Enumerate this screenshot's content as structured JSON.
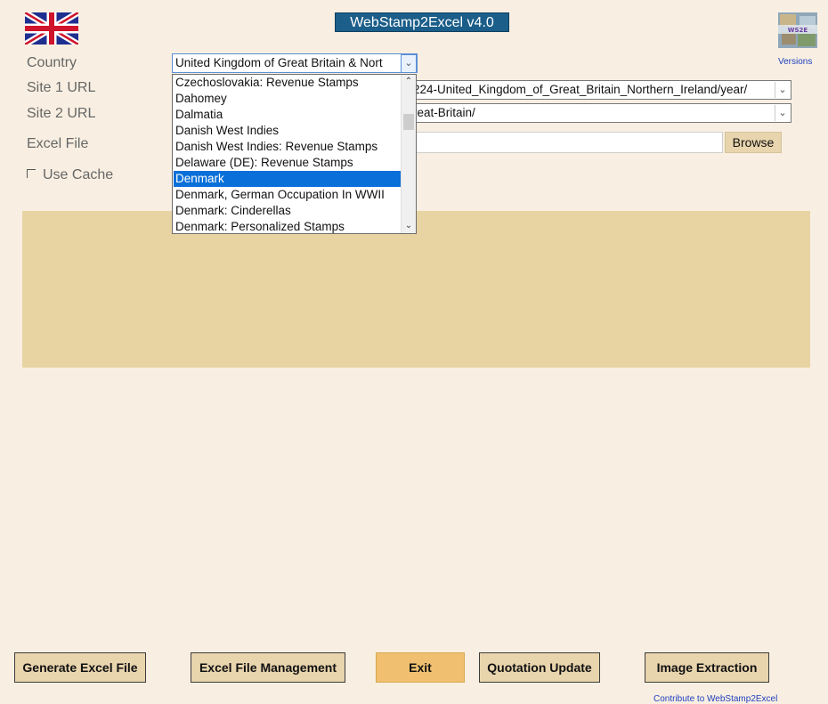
{
  "app": {
    "title": "WebStamp2Excel v4.0"
  },
  "header": {
    "versions_label": "Versions"
  },
  "form": {
    "country_label": "Country",
    "country_value": "United Kingdom of Great Britain & Nort",
    "site1_label": "Site 1 URL",
    "site1_value": "224-United_Kingdom_of_Great_Britain_Northern_Ireland/year/",
    "site2_label": "Site 2 URL",
    "site2_value": "reat-Britain/",
    "excel_label": "Excel File",
    "excel_value": "",
    "browse_label": "Browse",
    "cache_label": "Use Cache",
    "cache_checked": false
  },
  "dropdown": {
    "items": [
      "Czechoslovakia: Revenue Stamps",
      "Dahomey",
      "Dalmatia",
      "Danish West Indies",
      "Danish West Indies: Revenue Stamps",
      "Delaware (DE): Revenue Stamps",
      "Denmark",
      "Denmark, German Occupation In WWII",
      "Denmark: Cinderellas",
      "Denmark: Personalized Stamps"
    ],
    "selected_index": 6
  },
  "buttons": {
    "generate": "Generate Excel File",
    "management": "Excel File Management",
    "exit": "Exit",
    "quotation": "Quotation Update",
    "image": "Image Extraction"
  },
  "footer": {
    "contribute": "Contribute to WebStamp2Excel"
  },
  "colors": {
    "background": "#f8efe2",
    "panel": "#e8d4a2",
    "button": "#e8d4ad",
    "exit_button": "#f0c070",
    "title_banner": "#1b5e8a",
    "selection": "#0a6fd8"
  }
}
